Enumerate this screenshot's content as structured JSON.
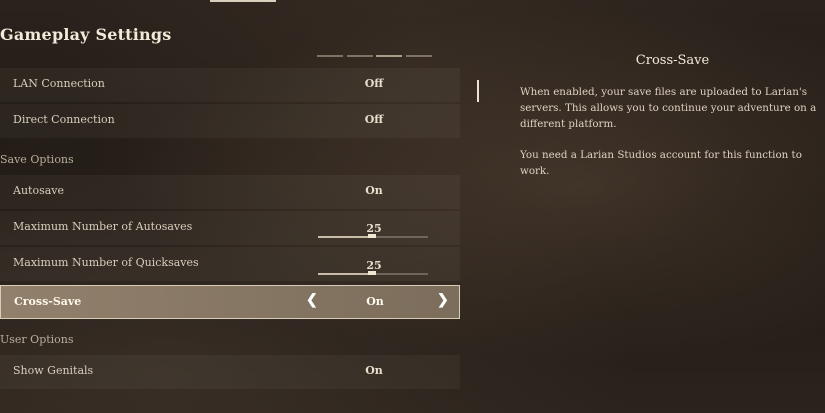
{
  "header": {
    "title": "Gameplay Settings"
  },
  "rows": {
    "lan": {
      "label": "LAN Connection",
      "value": "Off"
    },
    "direct": {
      "label": "Direct Connection",
      "value": "Off"
    },
    "autosave": {
      "label": "Autosave",
      "value": "On"
    },
    "max_autosaves": {
      "label": "Maximum Number of Autosaves",
      "value": "25"
    },
    "max_quicksaves": {
      "label": "Maximum Number of Quicksaves",
      "value": "25"
    },
    "cross_save": {
      "label": "Cross-Save",
      "value": "On"
    },
    "show_genitals": {
      "label": "Show Genitals",
      "value": "On"
    }
  },
  "sections": {
    "save_options": "Save Options",
    "user_options": "User Options"
  },
  "info_panel": {
    "title": "Cross-Save",
    "paragraph1": "When enabled, your save files are uploaded to Larian's servers. This allows you to continue your adventure on a different platform.",
    "paragraph2": "You need a Larian Studios account for this function to work."
  },
  "icons": {
    "left": "chevron-left-icon",
    "right": "chevron-right-icon"
  }
}
